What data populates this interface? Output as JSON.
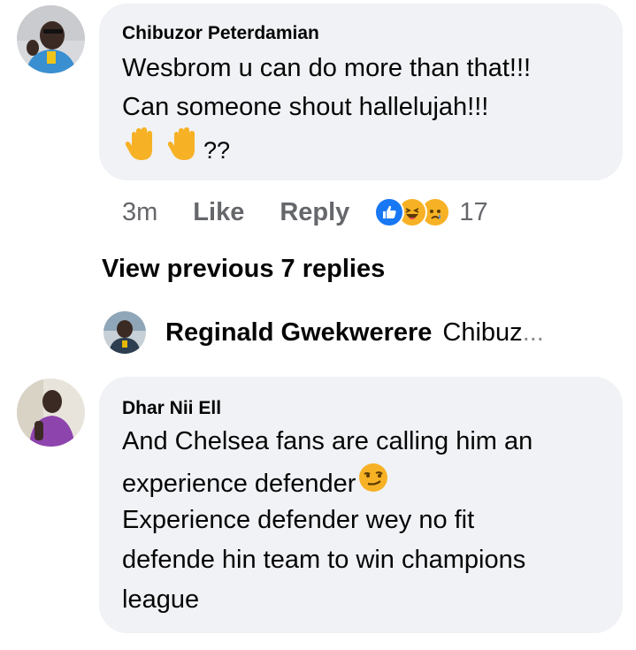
{
  "comment1": {
    "author": "Chibuzor Peterdamian",
    "lines": [
      "Wesbrom u can do more than that!!!",
      "Can someone shout hallelujah!!!"
    ],
    "emoji_suffix": "??",
    "emoji_icons": [
      "raised-hand-icon",
      "raised-hand-icon"
    ],
    "time": "3m",
    "like_label": "Like",
    "reply_label": "Reply",
    "reactions": [
      "like-reaction-icon",
      "haha-reaction-icon",
      "sad-reaction-icon"
    ],
    "reaction_count": "17"
  },
  "view_previous_label": "View previous 7 replies",
  "latest_reply": {
    "author": "Reginald Gwekwerere",
    "snippet": "Chibuz",
    "ellipsis": "..."
  },
  "comment2": {
    "author": "Dhar Nii Ell",
    "lines": [
      "And Chelsea fans are calling him an",
      "experience defender",
      "Experience defender wey no fit",
      "defende hin team to win champions",
      "league"
    ],
    "inline_emoji": "smirking-face-icon"
  },
  "colors": {
    "bubble": "#f0f2f5",
    "secondary_text": "#65676b",
    "like_blue": "#1877f2",
    "reaction_yellow": "#f7b125"
  }
}
